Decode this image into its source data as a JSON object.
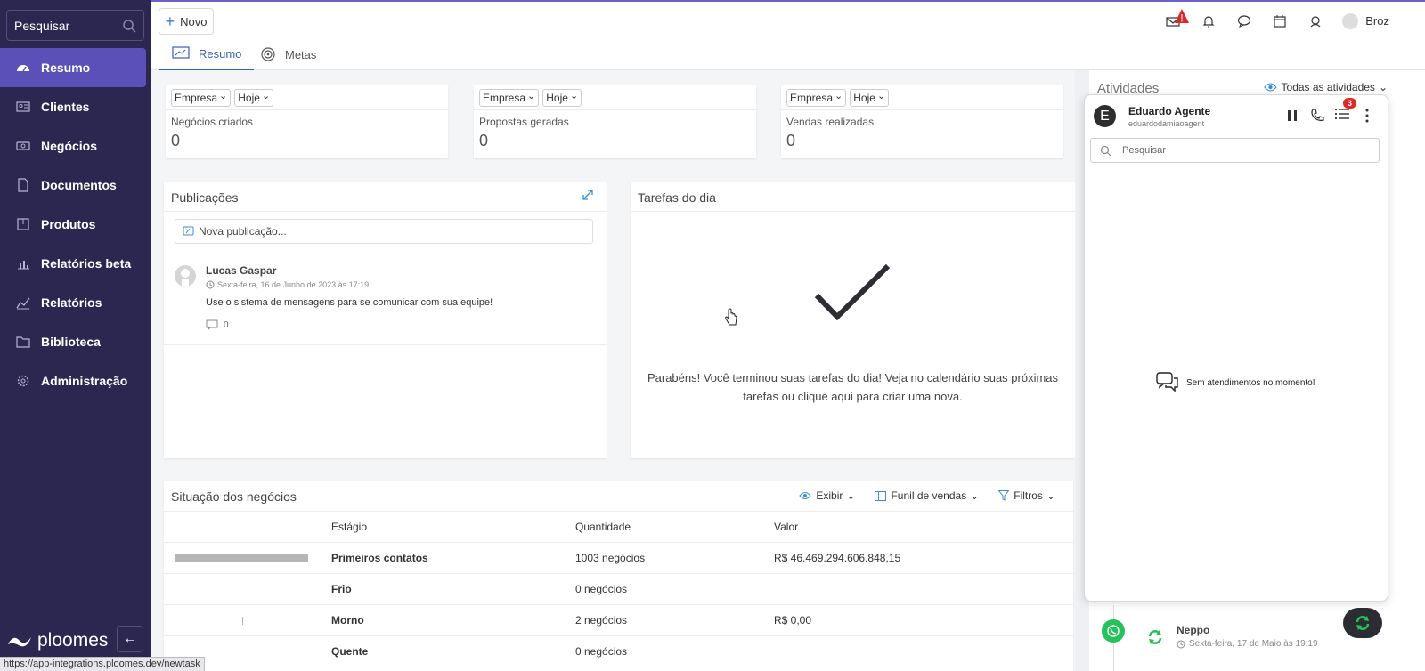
{
  "sidebar": {
    "search_label": "Pesquisar",
    "items": [
      {
        "label": "Resumo",
        "active": true
      },
      {
        "label": "Clientes"
      },
      {
        "label": "Negócios"
      },
      {
        "label": "Documentos"
      },
      {
        "label": "Produtos"
      },
      {
        "label": "Relatórios beta"
      },
      {
        "label": "Relatórios"
      },
      {
        "label": "Biblioteca"
      },
      {
        "label": "Administração"
      }
    ],
    "logo_text": "ploomes",
    "collapse_icon": "←"
  },
  "status_url": "https://app-integrations.ploomes.dev/newtask",
  "topbar": {
    "new_label": "Novo",
    "user_name": "Broz"
  },
  "tabs": [
    {
      "label": "Resumo",
      "active": true
    },
    {
      "label": "Metas"
    }
  ],
  "metrics": [
    {
      "filter1": "Empresa",
      "filter2": "Hoje",
      "label": "Negócios criados",
      "value": "0"
    },
    {
      "filter1": "Empresa",
      "filter2": "Hoje",
      "label": "Propostas geradas",
      "value": "0"
    },
    {
      "filter1": "Empresa",
      "filter2": "Hoje",
      "label": "Vendas realizadas",
      "value": "0"
    }
  ],
  "publications": {
    "title": "Publicações",
    "input_placeholder": "Nova publicação...",
    "post": {
      "author": "Lucas Gaspar",
      "date": "Sexta-feira, 16 de Junho de 2023 às 17:19",
      "text": "Use o sistema de mensagens para se comunicar com sua equipe!",
      "comments": "0"
    }
  },
  "tasks": {
    "title": "Tarefas do dia",
    "message_line1": "Parabéns! Você terminou suas tarefas do dia! Veja no calendário suas próximas",
    "message_line2": "tarefas ou clique aqui para criar uma nova."
  },
  "deals": {
    "title": "Situação dos negócios",
    "actions": {
      "show": "Exibir",
      "funnel": "Funil de vendas",
      "filters": "Filtros"
    },
    "columns": [
      "Estágio",
      "Quantidade",
      "Valor"
    ],
    "rows": [
      {
        "stage": "Primeiros contatos",
        "qty": "1003 negócios",
        "value": "R$ 46.469.294.606.848,15",
        "bar": 1.0
      },
      {
        "stage": "Frio",
        "qty": "0 negócios",
        "value": "",
        "bar": 0
      },
      {
        "stage": "Morno",
        "qty": "2 negócios",
        "value": "R$ 0,00",
        "bar": 0.002
      },
      {
        "stage": "Quente",
        "qty": "0 negócios",
        "value": "",
        "bar": 0
      }
    ]
  },
  "activities": {
    "title": "Atividades",
    "filter": "Todas as atividades",
    "item": {
      "name": "Neppo",
      "date": "Sexta-feira, 17 de Maio às 19:19"
    }
  },
  "chat": {
    "agent_initial": "E",
    "agent_name": "Eduardo Agente",
    "agent_email": "eduardodamiaoagent",
    "badge": "3",
    "search_placeholder": "Pesquisar",
    "empty_message": "Sem atendimentos no momento!"
  },
  "colors": {
    "sidebar": "#2b2750",
    "active": "#5b4fb8",
    "accent": "#3b5fb0",
    "whatsapp": "#25c15a"
  }
}
